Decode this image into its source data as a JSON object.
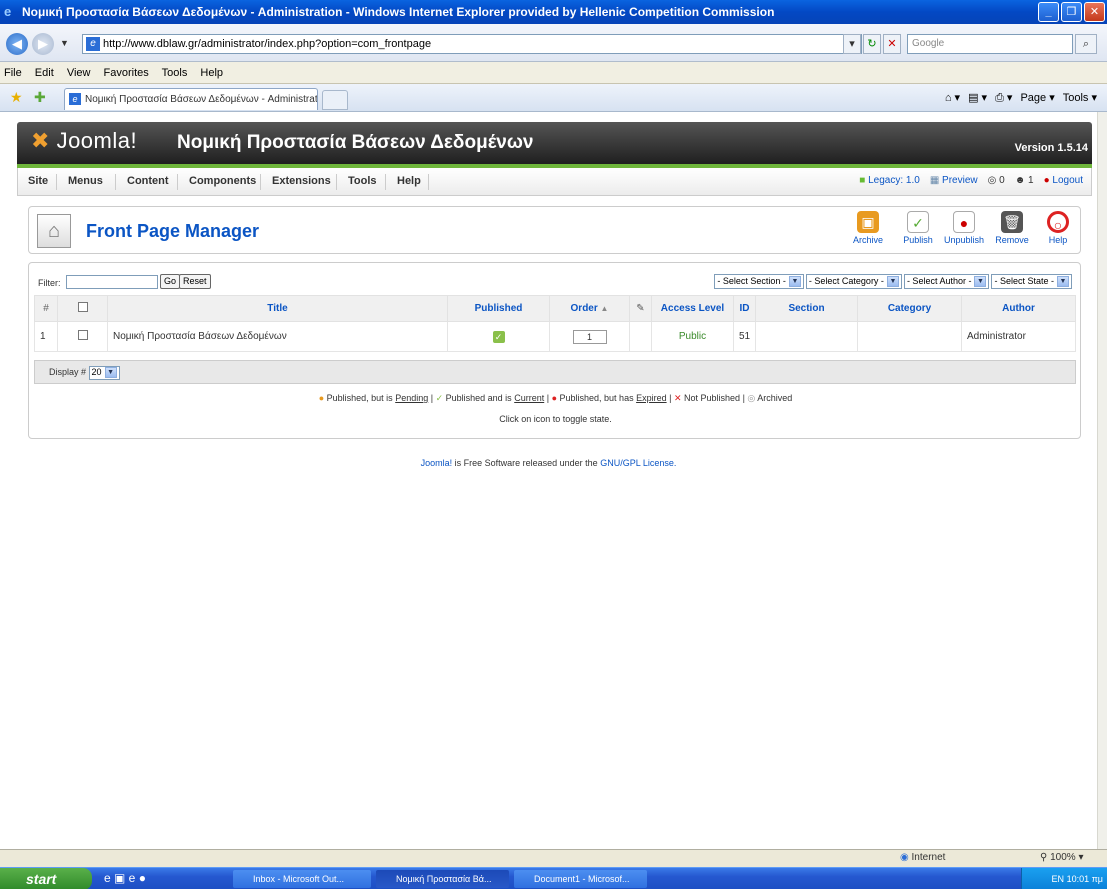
{
  "browser": {
    "window_title": "Νομική Προστασία Βάσεων Δεδομένων - Administration - Windows Internet Explorer provided by Hellenic Competition Commission",
    "url": "http://www.dblaw.gr/administrator/index.php?option=com_frontpage",
    "search_placeholder": "Google",
    "menu": [
      "File",
      "Edit",
      "View",
      "Favorites",
      "Tools",
      "Help"
    ],
    "tab_title": "Νομική Προστασία Βάσεων Δεδομένων - Administration",
    "command_bar": [
      "Page",
      "Tools"
    ],
    "status_zone": "Internet",
    "zoom": "100%"
  },
  "joomla": {
    "logo_text": "Joomla!",
    "site_title": "Νομική Προστασία Βάσεων Δεδομένων",
    "version": "Version 1.5.14",
    "menu": [
      "Site",
      "Menus",
      "Content",
      "Components",
      "Extensions",
      "Tools",
      "Help"
    ],
    "status": {
      "legacy": "Legacy: 1.0",
      "preview": "Preview",
      "messages": "0",
      "users": "1",
      "logout": "Logout"
    }
  },
  "page": {
    "title": "Front Page Manager",
    "toolbar": [
      "Archive",
      "Publish",
      "Unpublish",
      "Remove",
      "Help"
    ]
  },
  "filter": {
    "label": "Filter:",
    "go": "Go",
    "reset": "Reset",
    "selects": [
      "- Select Section -",
      "- Select Category -",
      "- Select Author -",
      "- Select State -"
    ]
  },
  "table": {
    "headers": [
      "#",
      "",
      "Title",
      "Published",
      "Order",
      "",
      "Access Level",
      "ID",
      "Section",
      "Category",
      "Author"
    ],
    "rows": [
      {
        "num": "1",
        "title": "Νομική Προστασία Βάσεων Δεδομένων",
        "order": "1",
        "access": "Public",
        "id": "51",
        "section": "",
        "category": "",
        "author": "Administrator"
      }
    ],
    "display_label": "Display #",
    "display_value": "20"
  },
  "legend": {
    "pending_pre": "Published, but is",
    "pending": "Pending",
    "current_pre": "Published and is",
    "current": "Current",
    "expired_pre": "Published, but has",
    "expired": "Expired",
    "not_published": "Not Published",
    "archived": "Archived",
    "toggle": "Click on icon to toggle state."
  },
  "footer": {
    "joomla_link": "Joomla!",
    "text": "is Free Software released under the",
    "license": "GNU/GPL License."
  },
  "taskbar": {
    "start": "start",
    "tasks": [
      "Inbox - Microsoft Out...",
      "Νομική Προστασία Βά...",
      "Document1 - Microsof..."
    ],
    "lang": "EN",
    "clock": "10:01 πμ"
  }
}
